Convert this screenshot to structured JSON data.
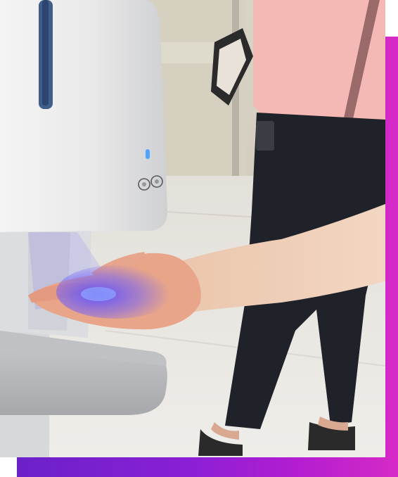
{
  "photo": {
    "subject": "hand-under-sanitizer-dispenser",
    "frame_colors": [
      "#6b21c8",
      "#8a1fd6",
      "#b51ed0",
      "#d62ac6"
    ],
    "light_color": "#5b4cff"
  }
}
